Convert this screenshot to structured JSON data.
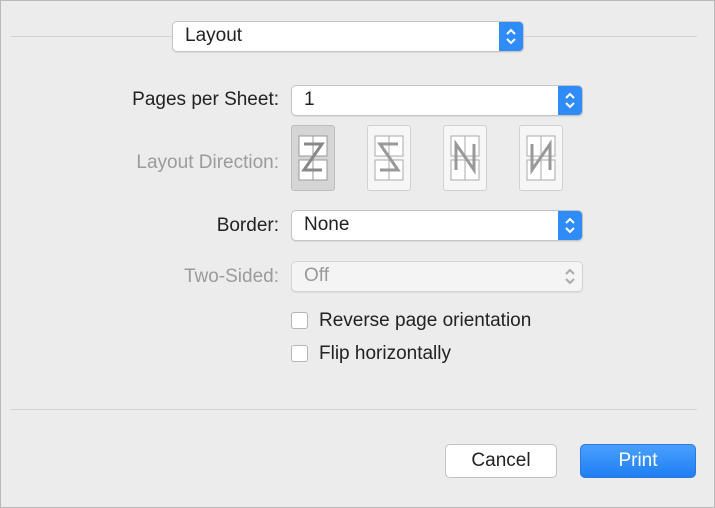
{
  "section_popup": {
    "value": "Layout"
  },
  "pages_per_sheet": {
    "label": "Pages per Sheet:",
    "value": "1"
  },
  "layout_direction": {
    "label": "Layout Direction:",
    "icons": [
      "z-direction-icon",
      "reverse-z-direction-icon",
      "n-reverse-direction-icon",
      "n-direction-icon"
    ]
  },
  "border": {
    "label": "Border:",
    "value": "None"
  },
  "two_sided": {
    "label": "Two-Sided:",
    "value": "Off"
  },
  "checkboxes": [
    {
      "label": "Reverse page orientation",
      "checked": false
    },
    {
      "label": "Flip horizontally",
      "checked": false
    }
  ],
  "buttons": {
    "cancel": "Cancel",
    "print": "Print"
  },
  "colors": {
    "accent": "#2f8cf7",
    "background": "#ececec"
  }
}
